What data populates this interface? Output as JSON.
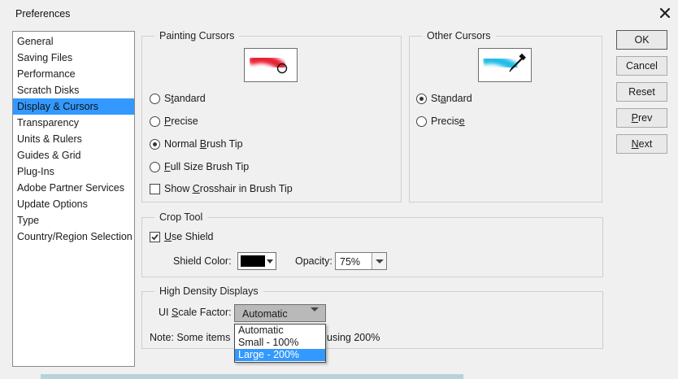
{
  "window": {
    "title": "Preferences"
  },
  "sidebar": {
    "items": [
      {
        "label": "General"
      },
      {
        "label": "Saving Files"
      },
      {
        "label": "Performance"
      },
      {
        "label": "Scratch Disks"
      },
      {
        "label": "Display & Cursors",
        "selected": true
      },
      {
        "label": "Transparency"
      },
      {
        "label": "Units & Rulers"
      },
      {
        "label": "Guides & Grid"
      },
      {
        "label": "Plug-Ins"
      },
      {
        "label": "Adobe Partner Services"
      },
      {
        "label": "Update Options"
      },
      {
        "label": "Type"
      },
      {
        "label": "Country/Region Selection"
      }
    ]
  },
  "painting_cursors": {
    "title": "Painting Cursors",
    "preview_icon": "red-brush-stroke-icon",
    "options": {
      "standard": {
        "pre": "S",
        "acc": "t",
        "post": "andard"
      },
      "precise": {
        "pre": "",
        "acc": "P",
        "post": "recise"
      },
      "normal_brush_tip": {
        "pre": "Normal ",
        "acc": "B",
        "post": "rush Tip"
      },
      "full_size_brush_tip": {
        "pre": "",
        "acc": "F",
        "post": "ull Size Brush Tip"
      }
    },
    "selected": "Normal Brush Tip",
    "crosshair": {
      "pre": "Show ",
      "acc": "C",
      "post": "rosshair in Brush Tip",
      "checked": false
    }
  },
  "other_cursors": {
    "title": "Other Cursors",
    "preview_icon": "eyedropper-cyan-stroke-icon",
    "options": {
      "standard": {
        "pre": "St",
        "acc": "a",
        "post": "ndard"
      },
      "precise": {
        "pre": "Precis",
        "acc": "e",
        "post": ""
      }
    },
    "selected": "Standard"
  },
  "crop_tool": {
    "title": "Crop Tool",
    "use_shield": {
      "pre": "",
      "acc": "U",
      "post": "se Shield",
      "checked": true
    },
    "shield_color_label": "Shield Color:",
    "shield_color": "#000000",
    "opacity_label": "Opacity:",
    "opacity_value": "75%"
  },
  "high_density": {
    "title": "High Density Displays",
    "ui_scale": {
      "pre": "UI ",
      "acc": "S",
      "post": "cale Factor:"
    },
    "ui_scale_value": "Automatic",
    "note_left": "Note: Some items",
    "note_right": "using 200%",
    "dropdown_options": [
      "Automatic",
      "Small - 100%",
      "Large - 200%"
    ],
    "highlighted_option": "Large - 200%"
  },
  "buttons": {
    "ok": {
      "pre": "OK",
      "acc": "",
      "post": ""
    },
    "cancel": {
      "pre": "Cancel",
      "acc": "",
      "post": ""
    },
    "reset": {
      "pre": "Reset",
      "acc": "",
      "post": ""
    },
    "prev": {
      "pre": "",
      "acc": "P",
      "post": "rev"
    },
    "next": {
      "pre": "",
      "acc": "N",
      "post": "ext"
    }
  },
  "colors": {
    "selection": "#3399ff",
    "brush_red": "#e8192c",
    "brush_cyan": "#18b9e6"
  }
}
